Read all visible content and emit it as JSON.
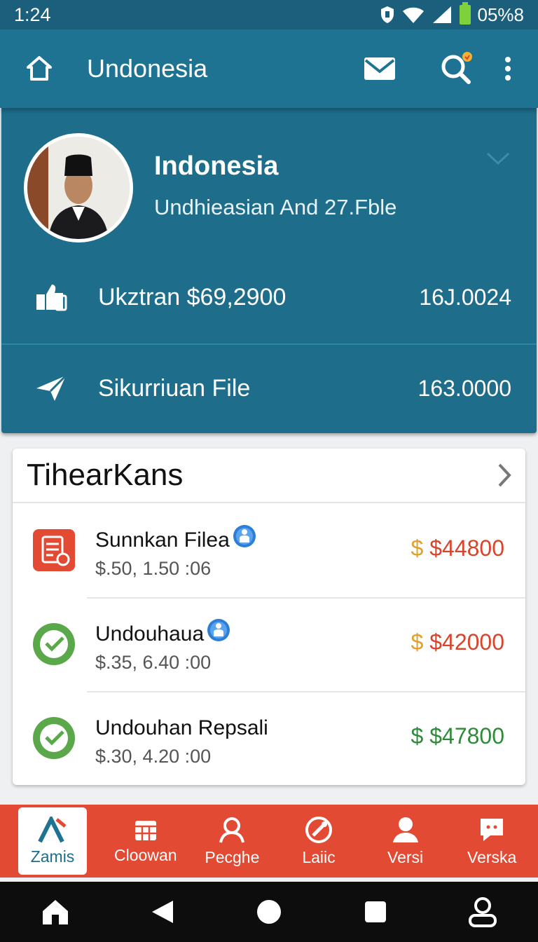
{
  "status_bar": {
    "time": "1:24",
    "battery_text": "05%8"
  },
  "app_bar": {
    "title": "Undonesia",
    "icons": [
      "home-icon",
      "mail-icon",
      "search-icon",
      "more-vert-icon"
    ]
  },
  "profile": {
    "name": "Indonesia",
    "subtitle": "Undhieasian  And 27.Fble",
    "rows": [
      {
        "icon": "thumbs-up-icon",
        "label": "Ukztran $69,2900",
        "value": "16J.0024"
      },
      {
        "icon": "send-icon",
        "label": "Sikurriuan File",
        "value": "163.0000"
      }
    ]
  },
  "card": {
    "title": "TihearKans",
    "transactions": [
      {
        "icon": "document-icon",
        "title": "Sunnkan Filea",
        "date": "$.50, 1.50 :06",
        "amount": "$ $44800",
        "amount_color": "#d8442c",
        "dollar_color": "#e0a02a"
      },
      {
        "icon": "check-circle-icon",
        "title": "Undouhaua",
        "date": "$.35, 6.40 :00",
        "amount": "$ $42000",
        "amount_color": "#d8442c",
        "dollar_color": "#e0a02a"
      },
      {
        "icon": "check-circle-icon",
        "title": "Undouhan Repsali",
        "date": "$.30, 4.20 :00",
        "amount": "$ $47800",
        "amount_color": "#2f8a3a",
        "dollar_color": "#2f8a3a"
      }
    ]
  },
  "bottom_nav": [
    {
      "label": "Zamis",
      "icon": "logo-a-icon",
      "active": true
    },
    {
      "label": "Cloowan",
      "icon": "calendar-icon"
    },
    {
      "label": "Pecghe",
      "icon": "person-icon"
    },
    {
      "label": "Laiic",
      "icon": "tool-icon"
    },
    {
      "label": "Versi",
      "icon": "user-icon"
    },
    {
      "label": "Verska",
      "icon": "chat-icon"
    }
  ],
  "colors": {
    "primary": "#1e7392",
    "panel": "#1e6e8b",
    "accent": "#e24a33"
  }
}
